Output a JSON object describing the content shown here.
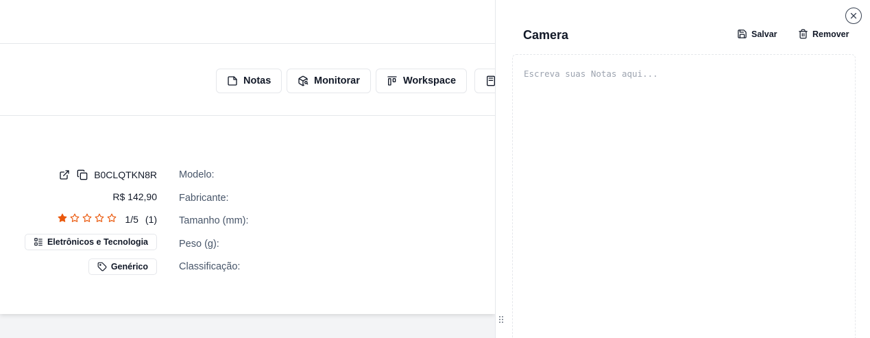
{
  "toolbar": {
    "notes_label": "Notas",
    "monitor_label": "Monitorar",
    "workspace_label": "Workspace"
  },
  "product": {
    "asin": "B0CLQTKN8R",
    "price": "R$ 142,90",
    "rating": {
      "text": "1/5",
      "count": "(1)",
      "stars_filled": 1,
      "stars_total": 5
    },
    "category": "Eletrônicos e Tecnologia",
    "brand": "Genérico"
  },
  "specs": {
    "model_label": "Modelo:",
    "manufacturer_label": "Fabricante:",
    "size_label": "Tamanho (mm):",
    "weight_label": "Peso (g):",
    "rank_label": "Classificação:"
  },
  "panel": {
    "title": "Camera",
    "save_label": "Salvar",
    "remove_label": "Remover",
    "notes_placeholder": "Escreva suas Notas aqui...",
    "notes_value": ""
  },
  "colors": {
    "star": "#ea580c",
    "border": "#e5e7eb",
    "muted_text": "#475569"
  },
  "icons": {
    "notes": "sticky-note-icon",
    "monitor": "package-search-icon",
    "workspace": "layout-icon",
    "external": "external-link-icon",
    "copy": "copy-icon",
    "category": "list-tree-icon",
    "brand": "tag-icon",
    "close": "close-icon",
    "save": "save-icon",
    "remove": "trash-icon"
  }
}
